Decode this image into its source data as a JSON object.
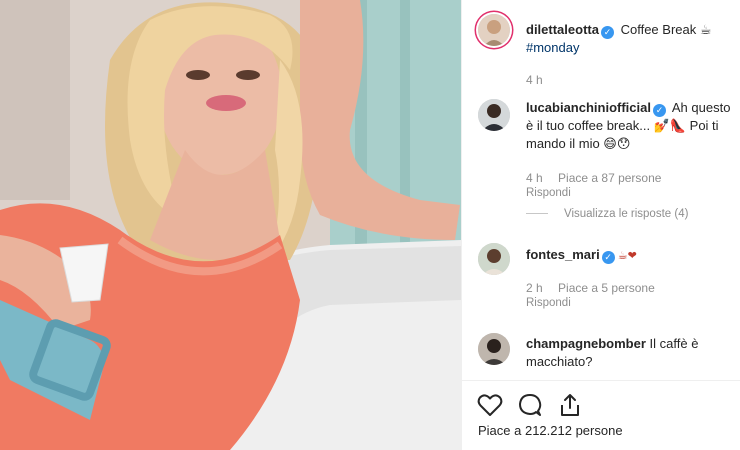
{
  "post": {
    "author": "dilettaleotta",
    "caption": "Coffee Break ☕",
    "hashtag": "#monday",
    "time": "4 h"
  },
  "comments": [
    {
      "username": "lucabianchiniofficial",
      "verified": true,
      "text_line1": "Ah questo",
      "text_line2": "è il tuo coffee break... 💅👠 Poi ti",
      "text_line3": "mando il mio 😄😯",
      "time": "4 h",
      "likes": "Piace a 87 persone",
      "reply": "Rispondi",
      "view_replies": "Visualizza le risposte (4)"
    },
    {
      "username": "fontes_mari",
      "verified": true,
      "text": "☕❤",
      "time": "2 h",
      "likes": "Piace a 5 persone",
      "reply": "Rispondi"
    },
    {
      "username": "champagnebomber",
      "verified": false,
      "text_line1": "Il caffè è",
      "text_line2": "macchiato?"
    }
  ],
  "actions": {
    "like_icon": "heart-icon",
    "comment_icon": "comment-icon",
    "share_icon": "share-icon"
  },
  "likes_total": "Piace a 212.212 persone",
  "colors": {
    "accent": "#3897f0",
    "muted": "#8e8e8e",
    "text": "#262626",
    "hashtag": "#003569"
  }
}
